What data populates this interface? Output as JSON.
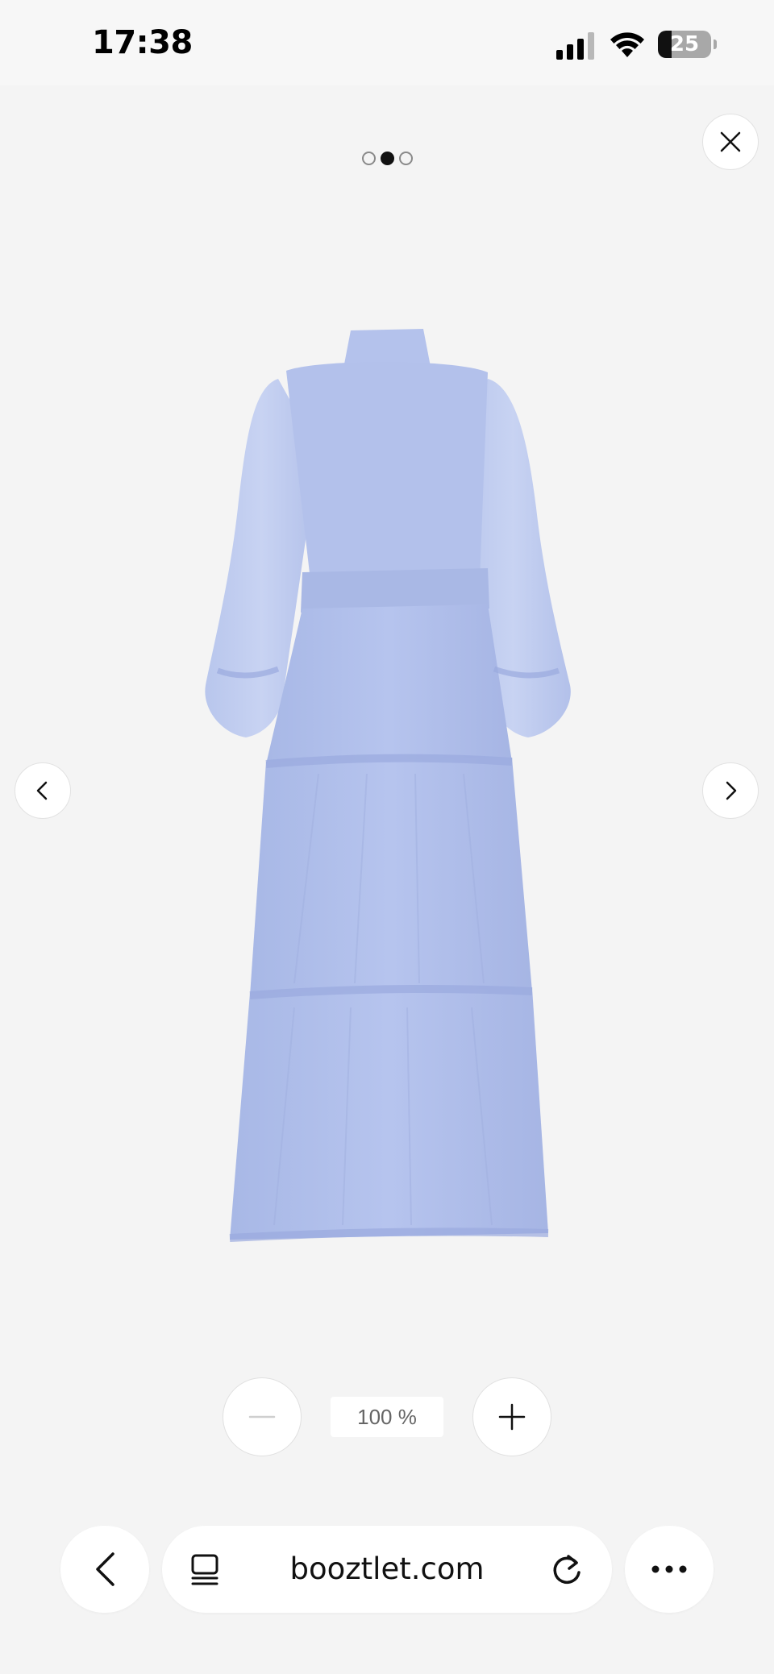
{
  "status_bar": {
    "time": "17:38",
    "battery_level": "25",
    "battery_fraction": 0.25,
    "icons": [
      "signal-icon",
      "wifi-icon",
      "battery-icon"
    ]
  },
  "viewer": {
    "image_count": 3,
    "active_index": 1,
    "icons": [
      "close-icon",
      "chevron-left-icon",
      "chevron-right-icon"
    ],
    "product_image": {
      "description_icon": "dress-image",
      "color": "#aebde9"
    }
  },
  "zoom": {
    "level": "100 %",
    "icons": [
      "minus-icon",
      "plus-icon"
    ]
  },
  "browser": {
    "url": "booztlet.com",
    "icons": [
      "chevron-left-icon",
      "tabs-icon",
      "reload-icon",
      "more-icon"
    ]
  }
}
